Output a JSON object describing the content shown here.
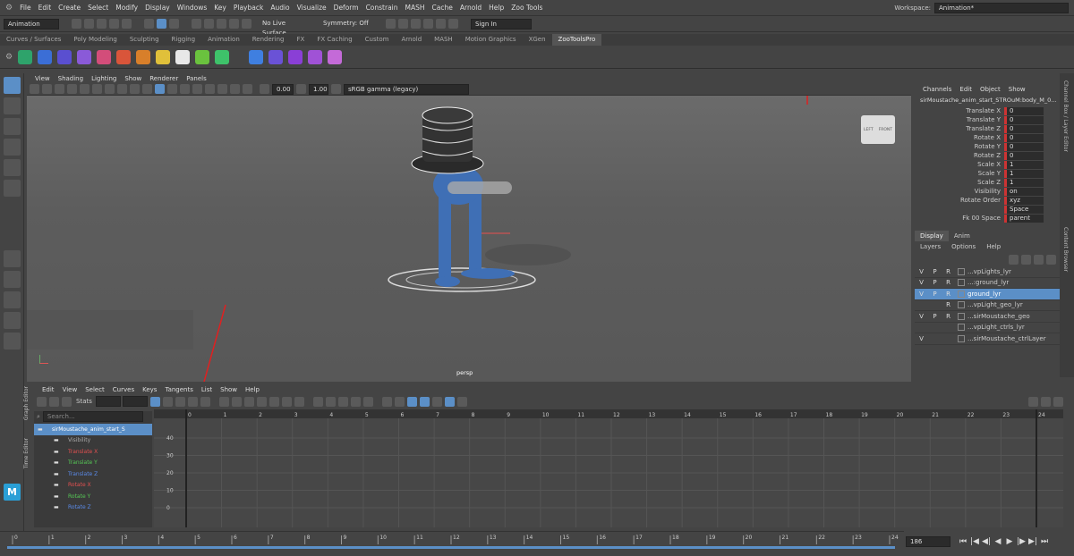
{
  "menubar": {
    "items": [
      "File",
      "Edit",
      "Create",
      "Select",
      "Modify",
      "Display",
      "Windows",
      "Key",
      "Playback",
      "Audio",
      "Visualize",
      "Deform",
      "Constrain",
      "MASH",
      "Cache",
      "Arnold",
      "Help",
      "Zoo Tools"
    ],
    "workspace_label": "Workspace:",
    "workspace_value": "Animation*"
  },
  "statusline": {
    "mode": "Animation",
    "live_surface": "No Live Surface",
    "symmetry": "Symmetry: Off",
    "sign_in": "Sign In"
  },
  "shelf_tabs": [
    "Curves / Surfaces",
    "Poly Modeling",
    "Sculpting",
    "Rigging",
    "Animation",
    "Rendering",
    "FX",
    "FX Caching",
    "Custom",
    "Arnold",
    "MASH",
    "Motion Graphics",
    "XGen",
    "ZooToolsPro"
  ],
  "active_shelf": "ZooToolsPro",
  "shelf_icon_colors": [
    "#2ea36b",
    "#3b6ed6",
    "#5a4fd0",
    "#8a5ad8",
    "#d34d7a",
    "#d9553a",
    "#d87f2a",
    "#e0c03a",
    "#e8e8e8",
    "#6ac23e",
    "#3ec26a",
    "#3f7fe0",
    "#6a52d6",
    "#8a3fd6",
    "#a052d6",
    "#c46ad8"
  ],
  "viewport": {
    "menu": [
      "View",
      "Shading",
      "Lighting",
      "Show",
      "Renderer",
      "Panels"
    ],
    "exposure": "0.00",
    "gamma": "1.00",
    "color_space": "sRGB gamma (legacy)",
    "camera_label": "persp",
    "cube_faces": [
      "LEFT",
      "FRONT"
    ]
  },
  "channel_box": {
    "menu": [
      "Channels",
      "Edit",
      "Object",
      "Show"
    ],
    "object": "sirMoustache_anim_start_STROuM:body_M_0...",
    "channels": [
      {
        "name": "Translate X",
        "value": "0"
      },
      {
        "name": "Translate Y",
        "value": "0"
      },
      {
        "name": "Translate Z",
        "value": "0"
      },
      {
        "name": "Rotate X",
        "value": "0"
      },
      {
        "name": "Rotate Y",
        "value": "0"
      },
      {
        "name": "Rotate Z",
        "value": "0"
      },
      {
        "name": "Scale X",
        "value": "1"
      },
      {
        "name": "Scale Y",
        "value": "1"
      },
      {
        "name": "Scale Z",
        "value": "1"
      },
      {
        "name": "Visibility",
        "value": "on"
      },
      {
        "name": "Rotate Order",
        "value": "xyz"
      },
      {
        "name": "",
        "value": "Space"
      },
      {
        "name": "Fk 00 Space",
        "value": "parent"
      }
    ]
  },
  "side_tabs": [
    "Channel Box / Layer Editor",
    "Content Browser"
  ],
  "layers": {
    "tabs": [
      "Display",
      "Anim"
    ],
    "menu": [
      "Layers",
      "Options",
      "Help"
    ],
    "rows": [
      {
        "v": "V",
        "p": "P",
        "r": "R",
        "name": "...vpLights_lyr",
        "selected": false
      },
      {
        "v": "V",
        "p": "P",
        "r": "R",
        "name": "...:ground_lyr",
        "selected": false
      },
      {
        "v": "V",
        "p": "P",
        "r": "R",
        "name": "ground_lyr",
        "selected": true
      },
      {
        "v": "",
        "p": "",
        "r": "R",
        "name": "...vpLight_geo_lyr",
        "selected": false
      },
      {
        "v": "V",
        "p": "P",
        "r": "R",
        "name": "...sirMoustache_geo",
        "selected": false
      },
      {
        "v": "",
        "p": "",
        "r": "",
        "name": "...vpLight_ctrls_lyr",
        "selected": false
      },
      {
        "v": "V",
        "p": "",
        "r": "",
        "name": "...sirMoustache_ctrlLayer",
        "selected": false
      }
    ]
  },
  "graph_editor": {
    "menu": [
      "Edit",
      "View",
      "Select",
      "Curves",
      "Keys",
      "Tangents",
      "List",
      "Show",
      "Help"
    ],
    "stats_label": "Stats",
    "search_placeholder": "Search...",
    "side_labels": [
      "Graph Editor",
      "Time Editor"
    ],
    "outliner": [
      {
        "name": "sirMoustache_anim_start_S",
        "color": "#ffffff",
        "selected": true
      },
      {
        "name": "Visibility",
        "color": "#aaaaaa",
        "selected": false
      },
      {
        "name": "Translate X",
        "color": "#e25050",
        "selected": false
      },
      {
        "name": "Translate Y",
        "color": "#55c855",
        "selected": false
      },
      {
        "name": "Translate Z",
        "color": "#5a8ae8",
        "selected": false
      },
      {
        "name": "Rotate X",
        "color": "#e25050",
        "selected": false
      },
      {
        "name": "Rotate Y",
        "color": "#55c855",
        "selected": false
      },
      {
        "name": "Rotate Z",
        "color": "#5a8ae8",
        "selected": false
      }
    ],
    "frame_ticks": [
      "0",
      "1",
      "2",
      "3",
      "4",
      "5",
      "6",
      "7",
      "8",
      "9",
      "10",
      "11",
      "12",
      "13",
      "14",
      "15",
      "16",
      "17",
      "18",
      "19",
      "20",
      "21",
      "22",
      "23",
      "24"
    ],
    "value_ticks": [
      "40",
      "30",
      "20",
      "10",
      "0"
    ]
  },
  "timeline": {
    "ticks": [
      "0",
      "1",
      "2",
      "3",
      "4",
      "5",
      "6",
      "7",
      "8",
      "9",
      "10",
      "11",
      "12",
      "13",
      "14",
      "15",
      "16",
      "17",
      "18",
      "19",
      "20",
      "21",
      "22",
      "23",
      "24"
    ],
    "current_frame": "186"
  },
  "playback_buttons": [
    "⏮",
    "|◀",
    "◀|",
    "◀",
    "▶",
    "|▶",
    "▶|",
    "⏭"
  ],
  "colors": {
    "accent": "#5b8fc7",
    "channel_marker": "#cc3333",
    "annotation_arrow": "#e02020",
    "maya_logo": "#2a9fd6"
  }
}
